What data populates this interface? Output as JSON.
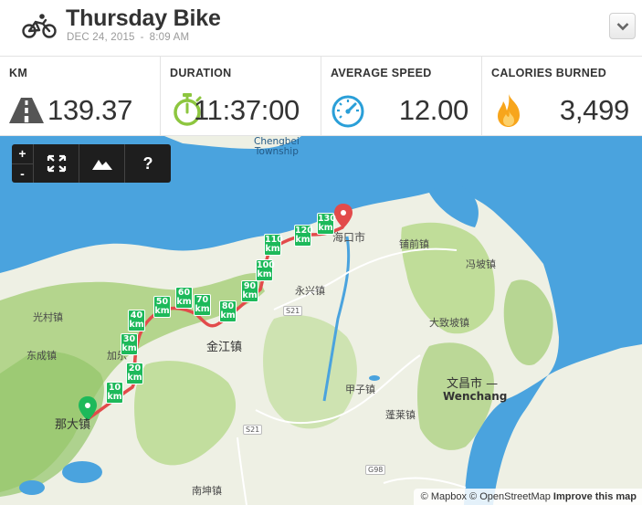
{
  "header": {
    "title": "Thursday Bike",
    "date": "DEC 24, 2015",
    "separator": "-",
    "time": "8:09 AM",
    "activity_icon": "bicycle-icon",
    "menu_icon": "chevron-down-icon"
  },
  "stats": [
    {
      "label": "KM",
      "value": "139.37",
      "icon": "road-icon"
    },
    {
      "label": "DURATION",
      "value": "11:37:00",
      "icon": "stopwatch-icon"
    },
    {
      "label": "AVERAGE SPEED",
      "value": "12.00",
      "icon": "speedometer-icon"
    },
    {
      "label": "CALORIES BURNED",
      "value": "3,499",
      "icon": "flame-icon"
    }
  ],
  "colors": {
    "water": "#4aa3de",
    "land": "#eef0e4",
    "route": "#e24b4b",
    "km_marker": "#1db95a",
    "stopwatch": "#8dc63f",
    "speedometer": "#2a9fd8",
    "flame": "#f7a51c"
  },
  "map": {
    "controls": {
      "zoom_in": "+",
      "zoom_out": "-",
      "help": "?",
      "fullscreen_icon": "fullscreen-icon",
      "terrain_icon": "mountain-icon"
    },
    "labels": {
      "chengbei": "Chengbei\nTownship",
      "haikou": "海口市",
      "puqian": "铺前镇",
      "fenggu": "冯坡镇",
      "yongxing": "永兴镇",
      "guangcun": "光村镇",
      "dongcheng": "东成镇",
      "jiali": "加乐",
      "jinjiang": "金江镇",
      "dazhi": "大致坡镇",
      "wenchang_cn": "文昌市 —",
      "wenchang_en": "Wenchang",
      "jiazi": "甲子镇",
      "penglai": "蓬莱镇",
      "nada": "那大镇",
      "nankun": "南坤镇"
    },
    "roads": [
      "S21",
      "S21",
      "G98"
    ],
    "km_markers": [
      "10\nkm",
      "20\nkm",
      "30\nkm",
      "40\nkm",
      "50\nkm",
      "60\nkm",
      "70\nkm",
      "80\nkm",
      "90\nkm",
      "100\nkm",
      "110\nkm",
      "120\nkm",
      "130\nkm"
    ],
    "attribution": {
      "mapbox": "© Mapbox",
      "osm": "© OpenStreetMap",
      "improve": "Improve this map"
    }
  }
}
